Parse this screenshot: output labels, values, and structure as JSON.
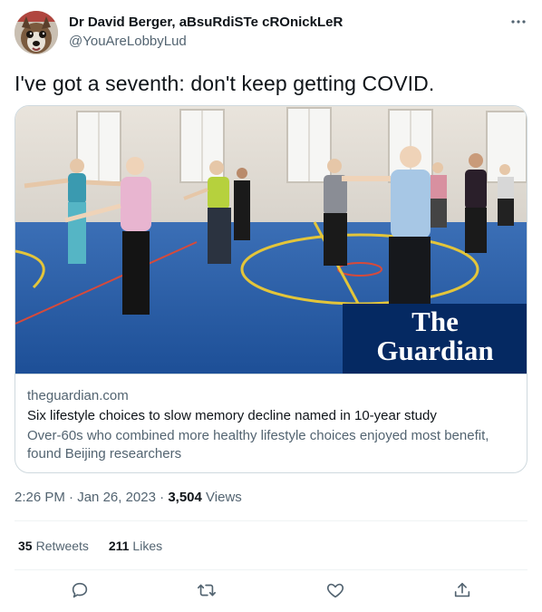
{
  "author": {
    "display_name": "Dr David Berger, aBsuRdiSTe cROnickLeR",
    "handle": "@YouAreLobbyLud",
    "avatar_icon": "dog-avatar"
  },
  "tweet": {
    "text": "I've got a seventh: don't keep getting COVID."
  },
  "card": {
    "domain": "theguardian.com",
    "title": "Six lifestyle choices to slow memory decline named in 10-year study",
    "description": "Over-60s who combined more healthy lifestyle choices enjoyed most benefit, found Beijing researchers",
    "logo_line1": "The",
    "logo_line2": "Guardian",
    "logo_bg": "#052962"
  },
  "meta": {
    "time": "2:26 PM",
    "separator": "·",
    "date": "Jan 26, 2023",
    "views_count": "3,504",
    "views_label": "Views"
  },
  "stats": {
    "retweets_count": "35",
    "retweets_label": "Retweets",
    "likes_count": "211",
    "likes_label": "Likes"
  },
  "actions": {
    "reply_icon": "reply-icon",
    "retweet_icon": "retweet-icon",
    "like_icon": "heart-icon",
    "share_icon": "share-icon"
  },
  "colors": {
    "text_primary": "#0f1419",
    "text_secondary": "#536471",
    "border": "#cfd9de"
  }
}
